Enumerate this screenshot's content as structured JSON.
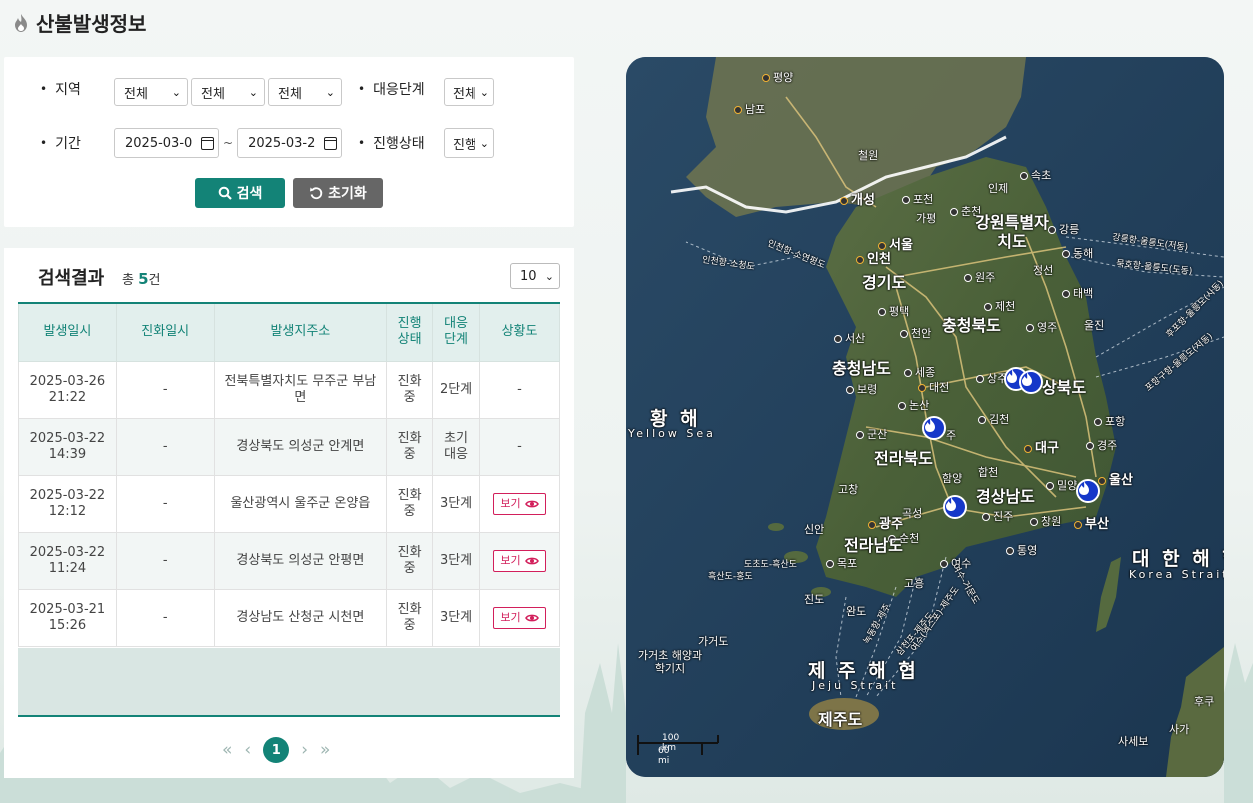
{
  "page": {
    "title": "산불발생정보"
  },
  "search": {
    "region_label": "지역",
    "region_values": [
      "전체",
      "전체",
      "전체"
    ],
    "response_level_label": "대응단계",
    "response_level_value": "전체",
    "period_label": "기간",
    "date_from": "2025-03-0",
    "date_to": "2025-03-2",
    "date_separator": "~",
    "progress_label": "진행상태",
    "progress_value": "진행",
    "search_button": "검색",
    "reset_button": "초기화"
  },
  "results": {
    "title": "검색결과",
    "count_prefix": "총",
    "count": "5",
    "count_suffix": "건",
    "page_size": "10",
    "columns": [
      "발생일시",
      "진화일시",
      "발생지주소",
      "진행상태",
      "대응단계",
      "상황도"
    ],
    "rows": [
      {
        "occurred": "2025-03-26 21:22",
        "extinguished": "-",
        "address": "전북특별자치도 무주군 부남면",
        "status": "진화중",
        "level": "2단계",
        "map": "-"
      },
      {
        "occurred": "2025-03-22 14:39",
        "extinguished": "-",
        "address": "경상북도 의성군 안계면",
        "status": "진화중",
        "level": "초기대응",
        "map": "-"
      },
      {
        "occurred": "2025-03-22 12:12",
        "extinguished": "-",
        "address": "울산광역시 울주군 온양읍",
        "status": "진화중",
        "level": "3단계",
        "map": "보기"
      },
      {
        "occurred": "2025-03-22 11:24",
        "extinguished": "-",
        "address": "경상북도 의성군 안평면",
        "status": "진화중",
        "level": "3단계",
        "map": "보기"
      },
      {
        "occurred": "2025-03-21 15:26",
        "extinguished": "-",
        "address": "경상남도 산청군 시천면",
        "status": "진화중",
        "level": "3단계",
        "map": "보기"
      }
    ],
    "pagination": {
      "first": "«",
      "prev": "‹",
      "current": "1",
      "next": "›",
      "last": "»"
    }
  },
  "map": {
    "provinces": [
      "강원특별자치도",
      "경기도",
      "충청북도",
      "충청남도",
      "상북도",
      "전라북도",
      "경상남도",
      "전라남도",
      "제주도"
    ],
    "cities": [
      "평양",
      "남포",
      "철원",
      "개성",
      "포천",
      "가평",
      "춘천",
      "인제",
      "속초",
      "강릉",
      "동해",
      "인천",
      "서울",
      "원주",
      "정선",
      "태백",
      "평택",
      "제천",
      "영주",
      "울진",
      "서산",
      "천안",
      "세종",
      "대전",
      "상주",
      "보령",
      "논산",
      "김천",
      "포항",
      "군산",
      "주",
      "대구",
      "경주",
      "함양",
      "합천",
      "밀양",
      "울산",
      "고창",
      "광주",
      "곡성",
      "진주",
      "창원",
      "부산",
      "신안",
      "순천",
      "여수",
      "통영",
      "목포",
      "고흥",
      "진도",
      "완도",
      "가거도",
      "가거초 해양과학기지",
      "후쿠",
      "사가",
      "사세보"
    ],
    "seas": [
      {
        "ko": "황 해",
        "en": "Yellow Sea"
      },
      {
        "ko": "대 한 해 협",
        "en": "Korea Strait"
      },
      {
        "ko": "제 주 해 협",
        "en": "Jeju Strait"
      }
    ],
    "routes": [
      "인천항-소청도",
      "인천항-소연평도",
      "강릉항-울릉도(저동)",
      "묵호항-울릉도(도동)",
      "후포항-울릉도(사동)",
      "포항구항-울릉도(저동)",
      "도초도-흑산도",
      "흑산도-홍도",
      "녹동항-제주",
      "여수(엑스포)-제주도",
      "삼천포-제주도",
      "여수-거문도"
    ],
    "scale": {
      "km": "100 km",
      "mi": "60 mi"
    },
    "fire_marker_count": 5
  }
}
